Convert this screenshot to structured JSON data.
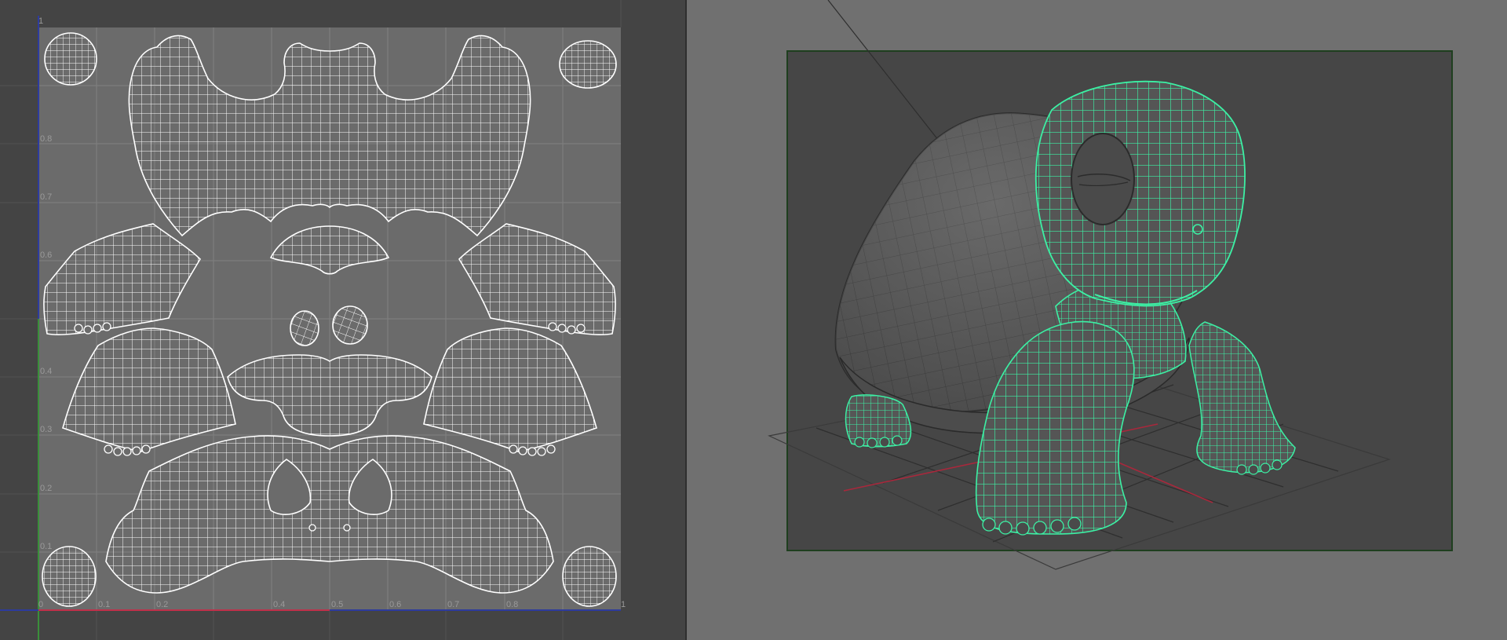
{
  "uv_editor": {
    "u_axis_labels": [
      "0",
      "0.1",
      "0.2",
      "0.4",
      "0.5",
      "0.6",
      "0.7",
      "0.8",
      "1"
    ],
    "v_axis_labels": [
      "1",
      "0.8",
      "0.7",
      "0.6",
      "0.4",
      "0.3",
      "0.2",
      "0.1"
    ],
    "colors": {
      "background": "#444444",
      "uv_space": "#6b6b6b",
      "grid": "#7e7e7e",
      "uv_wire": "#ffffff",
      "u_axis": "#c0304a",
      "v_axis": "#3a8f3a",
      "border_axis": "#2d3b9e"
    },
    "uv_shells": [
      "back-shell",
      "head-top",
      "front-leg-left",
      "front-leg-right",
      "eye-left",
      "eye-right",
      "jaw",
      "back-leg-left",
      "back-leg-right",
      "belly",
      "foot-top-left",
      "foot-top-right",
      "foot-bottom-left",
      "foot-bottom-right"
    ]
  },
  "viewport": {
    "model": "turtle",
    "colors": {
      "background": "#707070",
      "frame_bg": "#464646",
      "frame_border": "#1f3f1f",
      "mesh_shaded": "#5a5a5a",
      "selected_wire": "#3cf0a4",
      "ground_grid": "#2e2e2e",
      "ground_axis": "#a8283c"
    },
    "selected_parts": [
      "head",
      "neck",
      "front-left-leg",
      "front-right-leg",
      "back-left-foot"
    ]
  }
}
